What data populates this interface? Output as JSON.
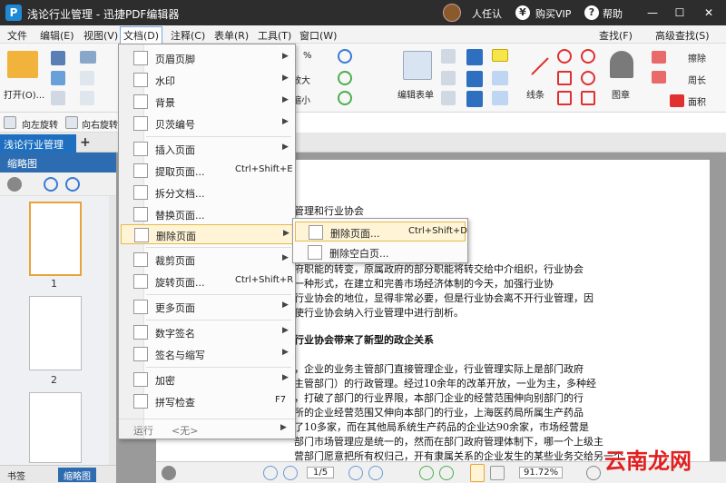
{
  "titlebar": {
    "logo": "P",
    "title": "浅论行业管理 - 迅捷PDF编辑器",
    "user": "人任认",
    "vip": "购买VIP",
    "vip_icon": "¥",
    "help": "帮助",
    "help_icon": "?",
    "minimize": "—",
    "maximize": "☐",
    "close": "✕"
  },
  "menubar": {
    "items": [
      "文件",
      "编辑(E)",
      "视图(V)",
      "文档(D)",
      "注释(C)",
      "表单(R)",
      "工具(T)",
      "窗口(W)"
    ],
    "find": "查找(F)",
    "advanced_find": "高级查找(S)"
  },
  "ribbon": {
    "open_label": "打开(O)...",
    "zoom_label": "放大",
    "shrink_label": "缩小",
    "edit_form_label": "编辑表单",
    "line_label": "线条",
    "stamp_label": "图章",
    "eraser1": "擦除",
    "eraser2": "周长",
    "area_label": "面积",
    "pct_label": "%"
  },
  "rotate": {
    "left": "向左旋转",
    "right": "向右旋转"
  },
  "tabs": {
    "doc": "浅论行业管理",
    "add": "+"
  },
  "sidebar": {
    "title": "缩略图",
    "page1": "1",
    "page2": "2",
    "tab_bookmarks": "书签",
    "tab_thumbs": "缩略图"
  },
  "document": {
    "lines": [
      "管理和行业协会",
      "府职能的转变，原属政府的部分职能将转交给中介组织，行业协会",
      "一种形式，在建立和完善市场经济体制的今天，加强行业协",
      "行业协会的地位，显得非常必要，但是行业协会离不开行业管理，因",
      "使行业协会纳入行业管理中进行剖析。",
      "行业协会带来了新型的政企关系",
      "，企业的业务主管部门直接管理企业，行业管理实际上是部门政府",
      "主管部门）的行政管理。经过10余年的改革开放，一业为主，多种经",
      "，打破了部门的行业界限，本部门企业的经营范围伸向别部门的行",
      "所的企业经营范围又伸向本部门的行业，上海医药局所属生产药品",
      "了10多家，而在其他局系统生产药品的企业达90余家，市场经营是",
      "部门市场管理应是统一的，然而在部门政府管理体制下，哪一个上级主",
      "营部门愿意把所有权归己，开有隶属关系的企业发生的某些业务交给另一个"
    ]
  },
  "statusbar": {
    "page_current": "1/5",
    "zoom": "91.72%"
  },
  "dropdown": {
    "items": [
      {
        "label": "页眉页脚",
        "shortcut": "",
        "arrow": "▶"
      },
      {
        "label": "水印",
        "shortcut": "",
        "arrow": "▶"
      },
      {
        "label": "背景",
        "shortcut": "",
        "arrow": "▶"
      },
      {
        "label": "贝茨编号",
        "shortcut": "",
        "arrow": "▶"
      },
      {
        "label": "插入页面",
        "shortcut": "",
        "arrow": "▶"
      },
      {
        "label": "提取页面...",
        "shortcut": "Ctrl+Shift+E",
        "arrow": ""
      },
      {
        "label": "拆分文档...",
        "shortcut": "",
        "arrow": ""
      },
      {
        "label": "替换页面...",
        "shortcut": "",
        "arrow": ""
      },
      {
        "label": "删除页面",
        "shortcut": "",
        "arrow": "▶"
      },
      {
        "label": "裁剪页面",
        "shortcut": "",
        "arrow": "▶"
      },
      {
        "label": "旋转页面...",
        "shortcut": "Ctrl+Shift+R",
        "arrow": ""
      },
      {
        "label": "更多页面",
        "shortcut": "",
        "arrow": "▶"
      },
      {
        "label": "数字签名",
        "shortcut": "",
        "arrow": "▶"
      },
      {
        "label": "签名与缩写",
        "shortcut": "",
        "arrow": "▶"
      },
      {
        "label": "加密",
        "shortcut": "",
        "arrow": "▶"
      },
      {
        "label": "拼写检查",
        "shortcut": "F7",
        "arrow": ""
      }
    ],
    "footer_label": "运行",
    "footer_value": "<无>"
  },
  "submenu": {
    "items": [
      {
        "label": "删除页面...",
        "shortcut": "Ctrl+Shift+D"
      },
      {
        "label": "删除空白页..."
      }
    ]
  },
  "watermark": "云南龙网",
  "colors": {
    "titlebar": "#2d2d2d",
    "accent": "#1e6fc0",
    "highlight": "#fff4d6",
    "watermark": "#e02020"
  }
}
